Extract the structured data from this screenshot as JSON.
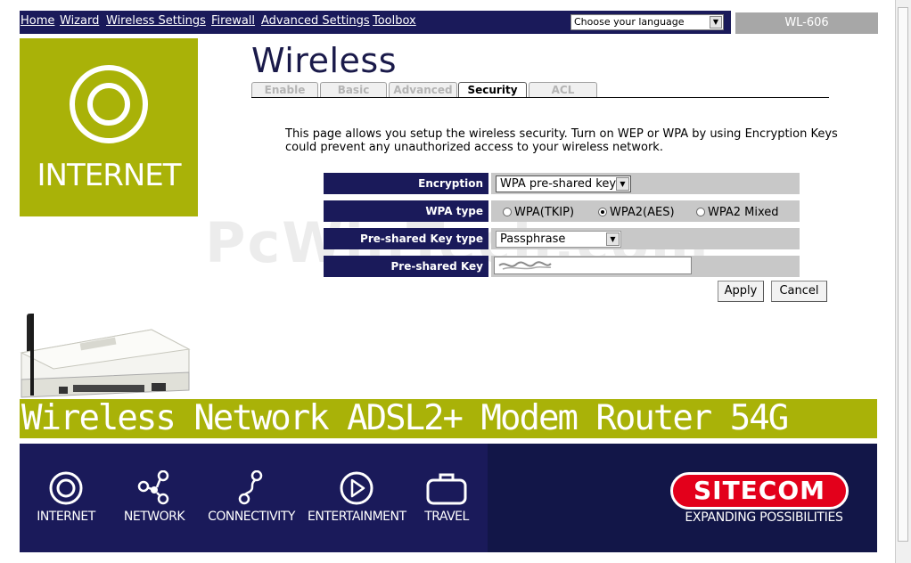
{
  "nav": {
    "links": [
      "Home",
      "Wizard",
      "Wireless Settings",
      "Firewall",
      "Advanced Settings",
      "Toolbox"
    ],
    "language_select": "Choose your language",
    "model": "WL-606"
  },
  "side_box": {
    "label": "INTERNET"
  },
  "page": {
    "title": "Wireless",
    "tabs": [
      "Enable",
      "Basic",
      "Advanced",
      "Security",
      "ACL"
    ],
    "active_tab": "Security",
    "description": "This page allows you setup the wireless security. Turn on WEP or WPA by using Encryption Keys could prevent any unauthorized access to your wireless network."
  },
  "form": {
    "encryption_label": "Encryption",
    "encryption_value": "WPA pre-shared key",
    "wpa_type_label": "WPA type",
    "wpa_type_options": [
      "WPA(TKIP)",
      "WPA2(AES)",
      "WPA2 Mixed"
    ],
    "wpa_type_selected": "WPA2(AES)",
    "key_type_label": "Pre-shared Key type",
    "key_type_value": "Passphrase",
    "key_label": "Pre-shared Key",
    "key_value": "",
    "apply": "Apply",
    "cancel": "Cancel"
  },
  "watermark": "PcWinTech.com",
  "banner": "Wireless Network ADSL2+ Modem Router 54G",
  "footer": {
    "items": [
      "INTERNET",
      "NETWORK",
      "CONNECTIVITY",
      "ENTERTAINMENT",
      "TRAVEL"
    ],
    "brand": "SITECOM",
    "tagline": "EXPANDING POSSIBILITIES"
  },
  "colors": {
    "navy": "#1a1a5a",
    "olive": "#a9b208",
    "brand_red": "#e3001b",
    "gray": "#a7a7a7"
  }
}
